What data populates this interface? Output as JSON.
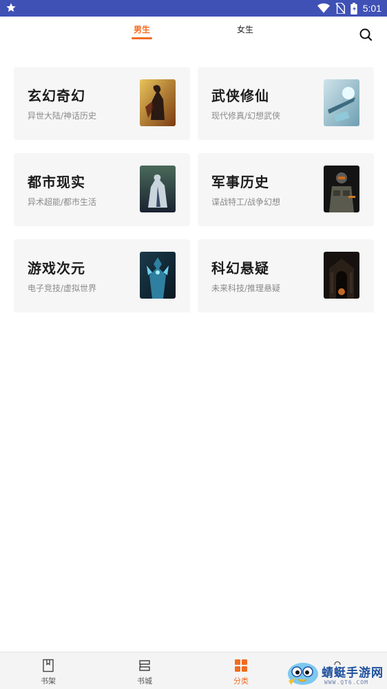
{
  "status_bar": {
    "time": "5:01"
  },
  "tabs": [
    {
      "label": "男生",
      "active": true
    },
    {
      "label": "女生",
      "active": false
    }
  ],
  "accent_color": "#f26c21",
  "categories": [
    {
      "title": "玄幻奇幻",
      "subtitle": "异世大陆/神话历史"
    },
    {
      "title": "武侠修仙",
      "subtitle": "现代修真/幻想武侠"
    },
    {
      "title": "都市现实",
      "subtitle": "异术超能/都市生活"
    },
    {
      "title": "军事历史",
      "subtitle": "谍战特工/战争幻想"
    },
    {
      "title": "游戏次元",
      "subtitle": "电子竞技/虚拟世界"
    },
    {
      "title": "科幻悬疑",
      "subtitle": "未来科技/推理悬疑"
    }
  ],
  "bottom_nav": [
    {
      "label": "书架",
      "icon": "book-icon",
      "active": false
    },
    {
      "label": "书城",
      "icon": "bookstore-icon",
      "active": false
    },
    {
      "label": "分类",
      "icon": "grid-icon",
      "active": true
    }
  ],
  "watermark": {
    "name": "蜻蜓手游网",
    "url": "WWW.QT6.COM"
  }
}
